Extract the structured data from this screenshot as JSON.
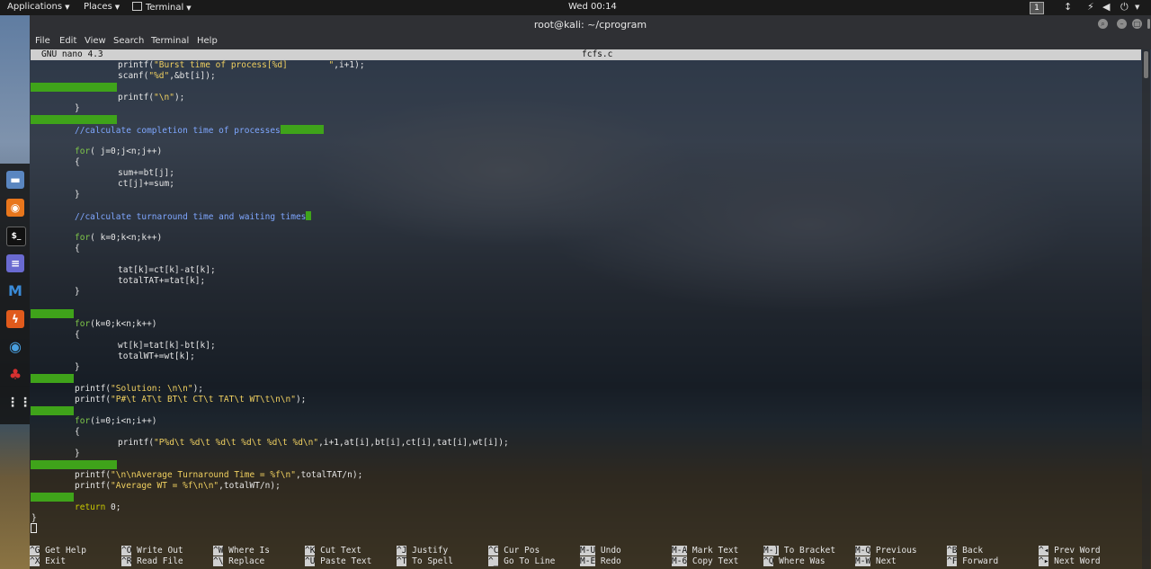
{
  "top_panel": {
    "applications": "Applications",
    "places": "Places",
    "terminal": "Terminal",
    "clock": "Wed 00:14",
    "workspace": "1"
  },
  "dock": [
    "files-icon",
    "firefox-esr-icon",
    "terminal-icon",
    "text-editor-icon",
    "metasploit-icon",
    "burpsuite-icon",
    "zenmap-icon",
    "cherrytree-icon",
    "app-grid-icon"
  ],
  "window": {
    "title": "root@kali: ~/cprogram",
    "menu": [
      "File",
      "Edit",
      "View",
      "Search",
      "Terminal",
      "Help"
    ]
  },
  "nano": {
    "version": "GNU nano 4.3",
    "filename": "fcfs.c"
  },
  "code_lines": [
    {
      "row": 0,
      "indent": 16,
      "parts": [
        [
          "",
          "printf("
        ],
        [
          "str",
          "\"Burst time of process[%d]        \""
        ],
        [
          "",
          ",i+1);"
        ]
      ]
    },
    {
      "row": 1,
      "indent": 16,
      "parts": [
        [
          "",
          "scanf("
        ],
        [
          "str",
          "\"%d\""
        ],
        [
          "",
          ",&bt[i]);"
        ]
      ]
    },
    {
      "row": 2,
      "ws": 16
    },
    {
      "row": 3,
      "indent": 16,
      "parts": [
        [
          "",
          "printf("
        ],
        [
          "str",
          "\"\\n\""
        ],
        [
          "",
          ");"
        ]
      ]
    },
    {
      "row": 4,
      "indent": 8,
      "parts": [
        [
          "",
          "}"
        ]
      ]
    },
    {
      "row": 5,
      "ws": 16
    },
    {
      "row": 6,
      "indent": 8,
      "parts": [
        [
          "cm",
          "//calculate completion time of processes"
        ]
      ],
      "trail": 8
    },
    {
      "row": 7
    },
    {
      "row": 8,
      "indent": 8,
      "parts": [
        [
          "kw",
          "for"
        ],
        [
          "",
          "( j=0;j<n;j++)"
        ]
      ]
    },
    {
      "row": 9,
      "indent": 8,
      "parts": [
        [
          "",
          "{"
        ]
      ]
    },
    {
      "row": 10,
      "indent": 16,
      "parts": [
        [
          "",
          "sum+=bt[j];"
        ]
      ]
    },
    {
      "row": 11,
      "indent": 16,
      "parts": [
        [
          "",
          "ct[j]+=sum;"
        ]
      ]
    },
    {
      "row": 12,
      "indent": 8,
      "parts": [
        [
          "",
          "}"
        ]
      ]
    },
    {
      "row": 13
    },
    {
      "row": 14,
      "indent": 8,
      "parts": [
        [
          "cm",
          "//calculate turnaround time and waiting times"
        ]
      ],
      "trail": 1
    },
    {
      "row": 15
    },
    {
      "row": 16,
      "indent": 8,
      "parts": [
        [
          "kw",
          "for"
        ],
        [
          "",
          "( k=0;k<n;k++)"
        ]
      ]
    },
    {
      "row": 17,
      "indent": 8,
      "parts": [
        [
          "",
          "{"
        ]
      ]
    },
    {
      "row": 18
    },
    {
      "row": 19,
      "indent": 16,
      "parts": [
        [
          "",
          "tat[k]=ct[k]-at[k];"
        ]
      ]
    },
    {
      "row": 20,
      "indent": 16,
      "parts": [
        [
          "",
          "totalTAT+=tat[k];"
        ]
      ]
    },
    {
      "row": 21,
      "indent": 8,
      "parts": [
        [
          "",
          "}"
        ]
      ]
    },
    {
      "row": 22
    },
    {
      "row": 23,
      "ws": 8
    },
    {
      "row": 24,
      "indent": 8,
      "parts": [
        [
          "kw",
          "for"
        ],
        [
          "",
          "(k=0;k<n;k++)"
        ]
      ]
    },
    {
      "row": 25,
      "indent": 8,
      "parts": [
        [
          "",
          "{"
        ]
      ]
    },
    {
      "row": 26,
      "indent": 16,
      "parts": [
        [
          "",
          "wt[k]=tat[k]-bt[k];"
        ]
      ]
    },
    {
      "row": 27,
      "indent": 16,
      "parts": [
        [
          "",
          "totalWT+=wt[k];"
        ]
      ]
    },
    {
      "row": 28,
      "indent": 8,
      "parts": [
        [
          "",
          "}"
        ]
      ]
    },
    {
      "row": 29,
      "ws": 8
    },
    {
      "row": 30,
      "indent": 8,
      "parts": [
        [
          "",
          "printf("
        ],
        [
          "str",
          "\"Solution: \\n\\n\""
        ],
        [
          "",
          ");"
        ]
      ]
    },
    {
      "row": 31,
      "indent": 8,
      "parts": [
        [
          "",
          "printf("
        ],
        [
          "str",
          "\"P#\\t AT\\t BT\\t CT\\t TAT\\t WT\\t\\n\\n\""
        ],
        [
          "",
          ");"
        ]
      ]
    },
    {
      "row": 32,
      "ws": 8
    },
    {
      "row": 33,
      "indent": 8,
      "parts": [
        [
          "kw",
          "for"
        ],
        [
          "",
          "(i=0;i<n;i++)"
        ]
      ]
    },
    {
      "row": 34,
      "indent": 8,
      "parts": [
        [
          "",
          "{"
        ]
      ]
    },
    {
      "row": 35,
      "indent": 16,
      "parts": [
        [
          "",
          "printf("
        ],
        [
          "str",
          "\"P%d\\t %d\\t %d\\t %d\\t %d\\t %d\\n\""
        ],
        [
          "",
          ",i+1,at[i],bt[i],ct[i],tat[i],wt[i]);"
        ]
      ]
    },
    {
      "row": 36,
      "indent": 8,
      "parts": [
        [
          "",
          "}"
        ]
      ]
    },
    {
      "row": 37,
      "ws": 16
    },
    {
      "row": 38,
      "indent": 8,
      "parts": [
        [
          "",
          "printf("
        ],
        [
          "str",
          "\"\\n\\nAverage Turnaround Time = %f\\n\""
        ],
        [
          "",
          ",totalTAT/n);"
        ]
      ]
    },
    {
      "row": 39,
      "indent": 8,
      "parts": [
        [
          "",
          "printf("
        ],
        [
          "str",
          "\"Average WT = %f\\n\\n\""
        ],
        [
          "",
          ",totalWT/n);"
        ]
      ]
    },
    {
      "row": 40,
      "ws": 8
    },
    {
      "row": 41,
      "indent": 8,
      "parts": [
        [
          "ret",
          "return"
        ],
        [
          "",
          " 0;"
        ]
      ]
    },
    {
      "row": 42,
      "indent": 0,
      "parts": [
        [
          "",
          "}"
        ]
      ]
    }
  ],
  "shortcuts": [
    [
      [
        "^G",
        "Get Help"
      ],
      [
        "^O",
        "Write Out"
      ],
      [
        "^W",
        "Where Is"
      ],
      [
        "^K",
        "Cut Text"
      ],
      [
        "^J",
        "Justify"
      ],
      [
        "^C",
        "Cur Pos"
      ],
      [
        "M-U",
        "Undo"
      ],
      [
        "M-A",
        "Mark Text"
      ],
      [
        "M-]",
        "To Bracket"
      ],
      [
        "M-Q",
        "Previous"
      ],
      [
        "^B",
        "Back"
      ],
      [
        "^◂",
        "Prev Word"
      ]
    ],
    [
      [
        "^X",
        "Exit"
      ],
      [
        "^R",
        "Read File"
      ],
      [
        "^\\",
        "Replace"
      ],
      [
        "^U",
        "Paste Text"
      ],
      [
        "^T",
        "To Spell"
      ],
      [
        "^_",
        "Go To Line"
      ],
      [
        "M-E",
        "Redo"
      ],
      [
        "M-6",
        "Copy Text"
      ],
      [
        "^Q",
        "Where Was"
      ],
      [
        "M-W",
        "Next"
      ],
      [
        "^F",
        "Forward"
      ],
      [
        "^▸",
        "Next Word"
      ]
    ]
  ],
  "colors": {
    "whitespace_highlight": "#3fa31a",
    "keyword": "#7fc74a",
    "string": "#f0d060",
    "comment": "#7fa7ff"
  }
}
